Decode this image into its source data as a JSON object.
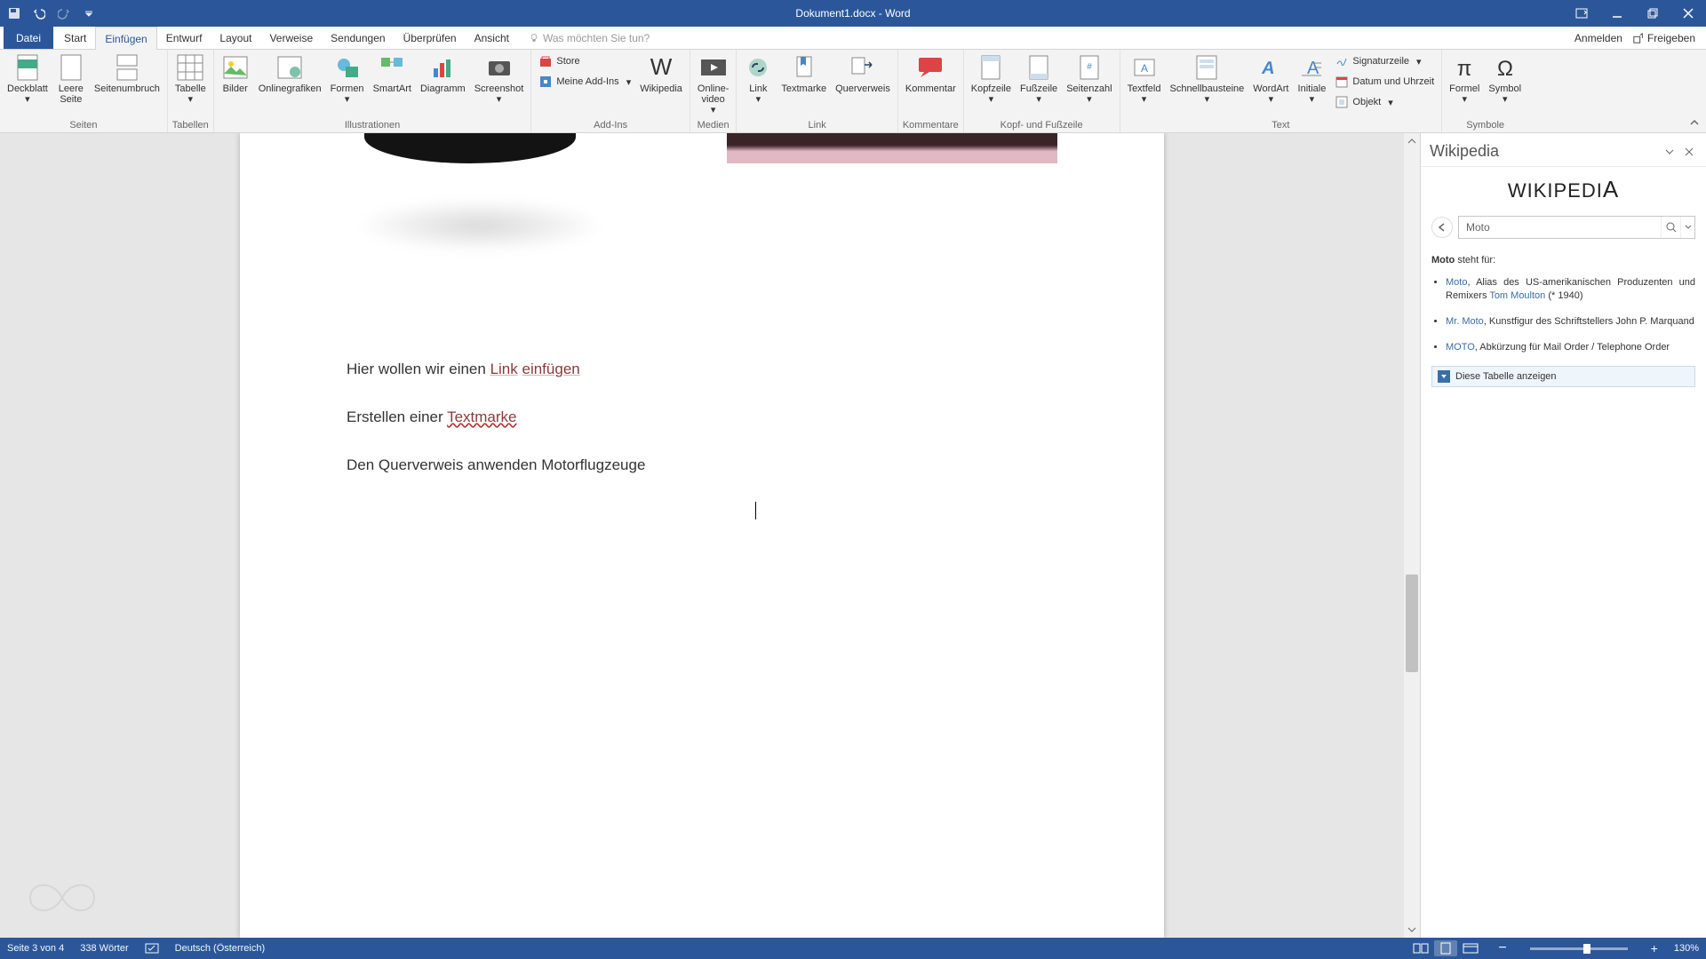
{
  "titlebar": {
    "doc_title": "Dokument1.docx - Word"
  },
  "tabs": {
    "file": "Datei",
    "items": [
      "Start",
      "Einfügen",
      "Entwurf",
      "Layout",
      "Verweise",
      "Sendungen",
      "Überprüfen",
      "Ansicht"
    ],
    "active_index": 1,
    "tell_me": "Was möchten Sie tun?",
    "sign_in": "Anmelden",
    "share": "Freigeben"
  },
  "ribbon": {
    "groups": {
      "seiten": {
        "label": "Seiten",
        "cover": "Deckblatt",
        "blank": "Leere\nSeite",
        "break": "Seitenumbruch"
      },
      "tabellen": {
        "label": "Tabellen",
        "table": "Tabelle"
      },
      "illustrationen": {
        "label": "Illustrationen",
        "pictures": "Bilder",
        "online": "Onlinegrafiken",
        "shapes": "Formen",
        "smartart": "SmartArt",
        "chart": "Diagramm",
        "screenshot": "Screenshot"
      },
      "addins": {
        "label": "Add-Ins",
        "store": "Store",
        "my_addins": "Meine Add-Ins",
        "wikipedia": "Wikipedia"
      },
      "medien": {
        "label": "Medien",
        "video": "Online-\nvideo"
      },
      "link": {
        "label": "Link",
        "link": "Link",
        "bookmark": "Textmarke",
        "crossref": "Querverweis"
      },
      "kommentare": {
        "label": "Kommentare",
        "comment": "Kommentar"
      },
      "kopf": {
        "label": "Kopf- und Fußzeile",
        "header": "Kopfzeile",
        "footer": "Fußzeile",
        "pagenum": "Seitenzahl"
      },
      "text": {
        "label": "Text",
        "textbox": "Textfeld",
        "quickparts": "Schnellbausteine",
        "wordart": "WordArt",
        "dropcap": "Initiale",
        "signature": "Signaturzeile",
        "datetime": "Datum und Uhrzeit",
        "object": "Objekt"
      },
      "symbole": {
        "label": "Symbole",
        "equation": "Formel",
        "symbol": "Symbol"
      }
    }
  },
  "document": {
    "line1_pre": "Hier wollen wir einen ",
    "line1_link1": "Link",
    "line1_sep": " ",
    "line1_link2": "einfügen",
    "line2_pre": "Erstellen einer ",
    "line2_link": "Textmarke",
    "line3": "Den Querverweis anwenden Motorflugzeuge"
  },
  "wikipedia": {
    "pane_title": "Wikipedia",
    "logo_text": "WIKIPEDI",
    "search_value": "Moto",
    "intro_term": "Moto",
    "intro_rest": " steht für:",
    "item1_a": "Moto",
    "item1_b": ", Alias des US-amerikanischen Produzenten und Remixers ",
    "item1_c": "Tom Moulton",
    "item1_d": " (* 1940)",
    "item2_a": "Mr. Moto",
    "item2_b": ", Kunstfigur des Schriftstellers John P. Marquand",
    "item3_a": "MOTO",
    "item3_b": ", Abkürzung für Mail Order / Telephone Order",
    "expand": "Diese Tabelle anzeigen"
  },
  "statusbar": {
    "page": "Seite 3 von 4",
    "words": "338 Wörter",
    "lang": "Deutsch (Österreich)",
    "zoom": "130%"
  }
}
